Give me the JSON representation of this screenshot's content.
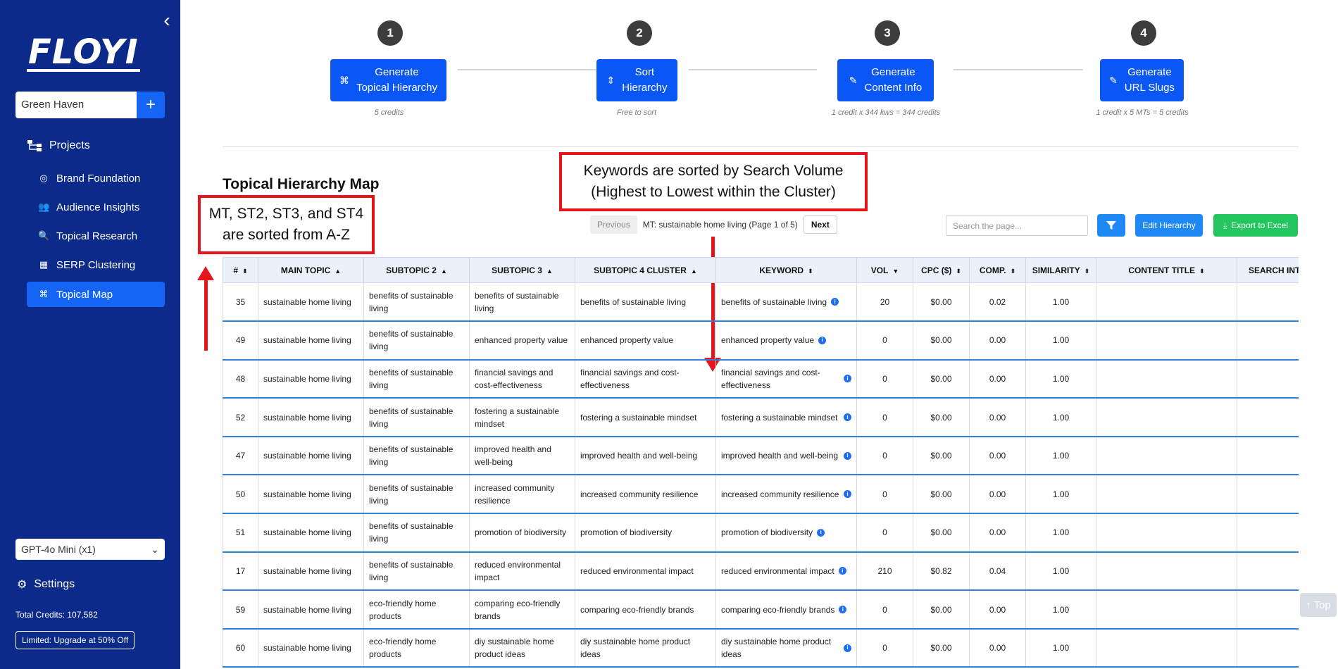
{
  "sidebar": {
    "logo": "FLOYI",
    "project": "Green Haven",
    "add_icon": "+",
    "projects_label": "Projects",
    "nav": [
      {
        "label": "Brand Foundation",
        "icon": "compass-icon"
      },
      {
        "label": "Audience Insights",
        "icon": "users-icon"
      },
      {
        "label": "Topical Research",
        "icon": "search-icon"
      },
      {
        "label": "SERP Clustering",
        "icon": "table-icon"
      },
      {
        "label": "Topical Map",
        "icon": "sitemap-icon"
      }
    ],
    "model": "GPT-4o Mini (x1)",
    "settings_label": "Settings",
    "credits": "Total Credits: 107,582",
    "upgrade": "Limited: Upgrade at 50% Off"
  },
  "steps": [
    {
      "num": "1",
      "label1": "Generate",
      "label2": "Topical Hierarchy",
      "note": "5 credits"
    },
    {
      "num": "2",
      "label1": "Sort",
      "label2": "Hierarchy",
      "note": "Free to sort"
    },
    {
      "num": "3",
      "label1": "Generate",
      "label2": "Content Info",
      "note": "1 credit x 344 kws = 344 credits"
    },
    {
      "num": "4",
      "label1": "Generate",
      "label2": "URL Slugs",
      "note": "1 credit x 5 MTs = 5 credits"
    }
  ],
  "page_title": "Topical Hierarchy Map",
  "annotations": {
    "left": {
      "line1": "MT, ST2, ST3, and ST4",
      "line2": "are sorted from A-Z"
    },
    "center": {
      "line1": "Keywords are sorted by Search Volume",
      "line2": "(Highest to Lowest within the Cluster)"
    }
  },
  "pager": {
    "prev": "Previous",
    "info": "MT: sustainable home living (Page 1 of 5)",
    "next": "Next"
  },
  "toolbar": {
    "search_placeholder": "Search the page...",
    "edit": "Edit Hierarchy",
    "export": "Export to Excel"
  },
  "table": {
    "headers": [
      "#",
      "MAIN TOPIC",
      "SUBTOPIC 2",
      "SUBTOPIC 3",
      "SUBTOPIC 4 CLUSTER",
      "KEYWORD",
      "VOL",
      "CPC ($)",
      "COMP.",
      "SIMILARITY",
      "CONTENT TITLE",
      "SEARCH INTENT"
    ],
    "rows": [
      [
        "35",
        "sustainable home living",
        "benefits of sustainable living",
        "benefits of sustainable living",
        "benefits of sustainable living",
        "benefits of sustainable living",
        "20",
        "$0.00",
        "0.02",
        "1.00"
      ],
      [
        "49",
        "sustainable home living",
        "benefits of sustainable living",
        "enhanced property value",
        "enhanced property value",
        "enhanced property value",
        "0",
        "$0.00",
        "0.00",
        "1.00"
      ],
      [
        "48",
        "sustainable home living",
        "benefits of sustainable living",
        "financial savings and cost-effectiveness",
        "financial savings and cost-effectiveness",
        "financial savings and cost-effectiveness",
        "0",
        "$0.00",
        "0.00",
        "1.00"
      ],
      [
        "52",
        "sustainable home living",
        "benefits of sustainable living",
        "fostering a sustainable mindset",
        "fostering a sustainable mindset",
        "fostering a sustainable mindset",
        "0",
        "$0.00",
        "0.00",
        "1.00"
      ],
      [
        "47",
        "sustainable home living",
        "benefits of sustainable living",
        "improved health and well-being",
        "improved health and well-being",
        "improved health and well-being",
        "0",
        "$0.00",
        "0.00",
        "1.00"
      ],
      [
        "50",
        "sustainable home living",
        "benefits of sustainable living",
        "increased community resilience",
        "increased community resilience",
        "increased community resilience",
        "0",
        "$0.00",
        "0.00",
        "1.00"
      ],
      [
        "51",
        "sustainable home living",
        "benefits of sustainable living",
        "promotion of biodiversity",
        "promotion of biodiversity",
        "promotion of biodiversity",
        "0",
        "$0.00",
        "0.00",
        "1.00"
      ],
      [
        "17",
        "sustainable home living",
        "benefits of sustainable living",
        "reduced environmental impact",
        "reduced environmental impact",
        "reduced environmental impact",
        "210",
        "$0.82",
        "0.04",
        "1.00"
      ],
      [
        "59",
        "sustainable home living",
        "eco-friendly home products",
        "comparing eco-friendly brands",
        "comparing eco-friendly brands",
        "comparing eco-friendly brands",
        "0",
        "$0.00",
        "0.00",
        "1.00"
      ],
      [
        "60",
        "sustainable home living",
        "eco-friendly home products",
        "diy sustainable home product ideas",
        "diy sustainable home product ideas",
        "diy sustainable home product ideas",
        "0",
        "$0.00",
        "0.00",
        "1.00"
      ]
    ]
  },
  "top_button": "↑ Top"
}
